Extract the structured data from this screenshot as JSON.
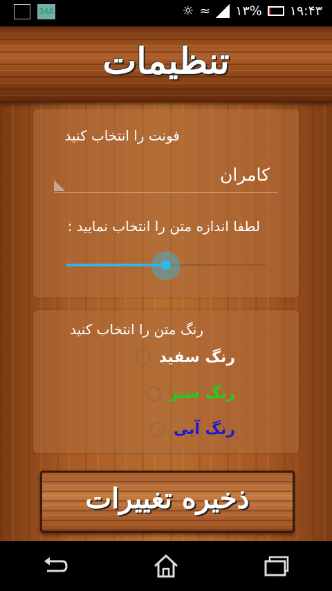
{
  "status_bar": {
    "notification_icons": [
      "image-icon",
      "34a-icon"
    ],
    "badge_text": "34A",
    "battery_text": "۱۳%",
    "battery_percent": 13,
    "time": "۱۹:۴۳"
  },
  "header": {
    "title": "تنظیمات"
  },
  "font_section": {
    "label": "فونت را انتخاب کنید",
    "selected_font": "کامران"
  },
  "size_section": {
    "label": "لطفا اندازه متن را انتخاب نمایید :",
    "slider_fraction": 0.5
  },
  "color_section": {
    "label": "رنگ متن را انتخاب کنید",
    "options": [
      {
        "label": "رنگ سفید",
        "color": "#ffffff"
      },
      {
        "label": "رنگ سبز",
        "color": "#22cc22"
      },
      {
        "label": "رنگ آبی",
        "color": "#1a1ad6"
      }
    ]
  },
  "save_button": {
    "label": "ذخیره تغییرات"
  },
  "accent_color": "#33b5e5",
  "navbar": [
    "back-icon",
    "home-icon",
    "recent-apps-icon"
  ]
}
